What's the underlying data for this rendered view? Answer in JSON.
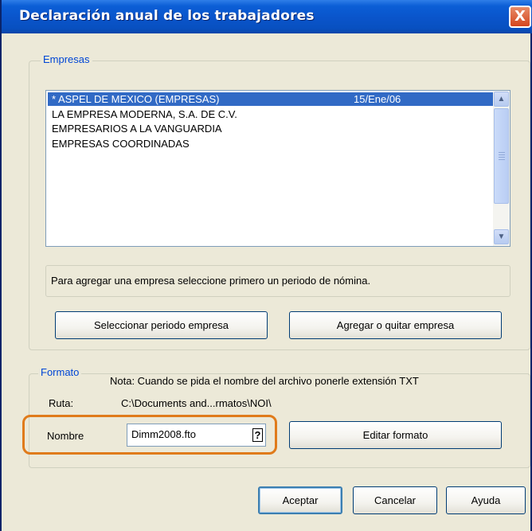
{
  "window": {
    "title": "Declaración anual de los trabajadores",
    "close_icon": "close-icon",
    "close_glyph": "X"
  },
  "empresas": {
    "legend": "Empresas",
    "items": [
      {
        "name": "* ASPEL DE MEXICO (EMPRESAS)",
        "date": "15/Ene/06",
        "selected": true
      },
      {
        "name": "LA EMPRESA MODERNA, S.A. DE C.V.",
        "date": ""
      },
      {
        "name": "EMPRESARIOS A LA VANGUARDIA",
        "date": ""
      },
      {
        "name": "EMPRESAS COORDINADAS",
        "date": ""
      }
    ],
    "scroll_up_glyph": "▲",
    "scroll_down_glyph": "▼",
    "info": "Para agregar una empresa seleccione primero un periodo de nómina.",
    "select_period_label": "Seleccionar periodo empresa",
    "add_remove_label": "Agregar o quitar empresa"
  },
  "formato": {
    "legend": "Formato",
    "note": "Nota: Cuando se pida el nombre del archivo ponerle extensión TXT",
    "ruta_label": "Ruta:",
    "ruta_value": "C:\\Documents and...rmatos\\NOI\\",
    "nombre_label": "Nombre",
    "nombre_value": "Dimm2008.fto",
    "help_glyph": "?",
    "edit_label": "Editar formato"
  },
  "footer": {
    "accept_label": "Aceptar",
    "cancel_label": "Cancelar",
    "help_label": "Ayuda"
  },
  "colors": {
    "title_bar": "#0a54ca",
    "selection": "#316ac5",
    "group_legend": "#0046d5",
    "highlight": "#e07b1b"
  }
}
